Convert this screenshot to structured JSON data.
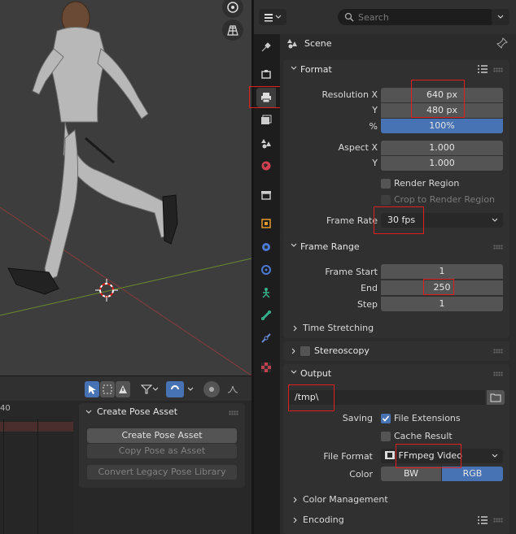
{
  "viewport": {
    "icons": [
      "gizmo-icon",
      "grid-icon"
    ]
  },
  "timeline": {
    "frame_label": "40",
    "pose_panel": {
      "title": "Create Pose Asset",
      "create_label": "Create Pose Asset",
      "copy_label": "Copy Pose as Asset",
      "convert_label": "Convert Legacy Pose Library"
    }
  },
  "header": {
    "search_placeholder": "Search"
  },
  "context": {
    "label": "Scene"
  },
  "format": {
    "title": "Format",
    "res_x_label": "Resolution X",
    "res_x": "640 px",
    "res_y_label": "Y",
    "res_y": "480 px",
    "pct_label": "%",
    "pct": "100%",
    "aspect_x_label": "Aspect X",
    "aspect_x": "1.000",
    "aspect_y_label": "Y",
    "aspect_y": "1.000",
    "render_region": "Render Region",
    "crop_region": "Crop to Render Region",
    "frame_rate_label": "Frame Rate",
    "frame_rate": "30 fps"
  },
  "frame_range": {
    "title": "Frame Range",
    "start_label": "Frame Start",
    "start": "1",
    "end_label": "End",
    "end": "250",
    "step_label": "Step",
    "step": "1",
    "time_stretching": "Time Stretching"
  },
  "stereoscopy": {
    "title": "Stereoscopy"
  },
  "output": {
    "title": "Output",
    "path": "/tmp\\",
    "saving_label": "Saving",
    "file_extensions": "File Extensions",
    "cache_result": "Cache Result",
    "file_format_label": "File Format",
    "file_format": "FFmpeg Video",
    "color_label": "Color",
    "color_bw": "BW",
    "color_rgb": "RGB",
    "color_management": "Color Management",
    "encoding": "Encoding"
  },
  "colors": {
    "accent": "#4772b3",
    "highlight": "#e0201e"
  }
}
